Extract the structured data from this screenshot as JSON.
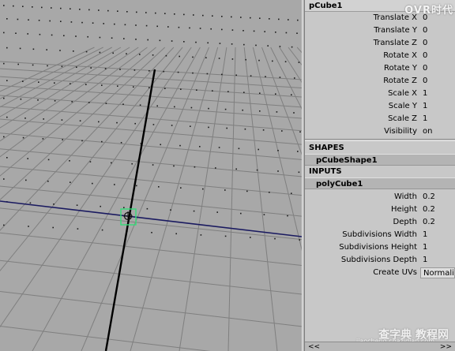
{
  "logo_text": "OVR时代",
  "viewport": {
    "background": "#a8a8a8",
    "grid_color": "#7f7f7f",
    "dot_color": "#1c1c1c",
    "horizon_axis_color": "#1a1a60",
    "vertical_axis_color": "#000000",
    "manipulator_color": "#33dd77"
  },
  "channel_box": {
    "node_name": "pCube1",
    "transform_attrs": [
      {
        "label": "Translate X",
        "value": "0"
      },
      {
        "label": "Translate Y",
        "value": "0"
      },
      {
        "label": "Translate Z",
        "value": "0"
      },
      {
        "label": "Rotate X",
        "value": "0"
      },
      {
        "label": "Rotate Y",
        "value": "0"
      },
      {
        "label": "Rotate Z",
        "value": "0"
      },
      {
        "label": "Scale X",
        "value": "1"
      },
      {
        "label": "Scale Y",
        "value": "1"
      },
      {
        "label": "Scale Z",
        "value": "1"
      },
      {
        "label": "Visibility",
        "value": "on"
      }
    ],
    "shapes_title": "SHAPES",
    "shape_name": "pCubeShape1",
    "inputs_title": "INPUTS",
    "input_name": "polyCube1",
    "input_attrs": [
      {
        "label": "Width",
        "value": "0.2"
      },
      {
        "label": "Height",
        "value": "0.2"
      },
      {
        "label": "Depth",
        "value": "0.2"
      },
      {
        "label": "Subdivisions Width",
        "value": "1"
      },
      {
        "label": "Subdivisions Height",
        "value": "1"
      },
      {
        "label": "Subdivisions Depth",
        "value": "1"
      },
      {
        "label": "Create UVs",
        "value": "Normalize"
      }
    ],
    "scroll_left": "<<",
    "scroll_right": ">>"
  },
  "watermark": {
    "main": "查字典 教程网",
    "sub": "jiaocheng.chazidian.com"
  }
}
